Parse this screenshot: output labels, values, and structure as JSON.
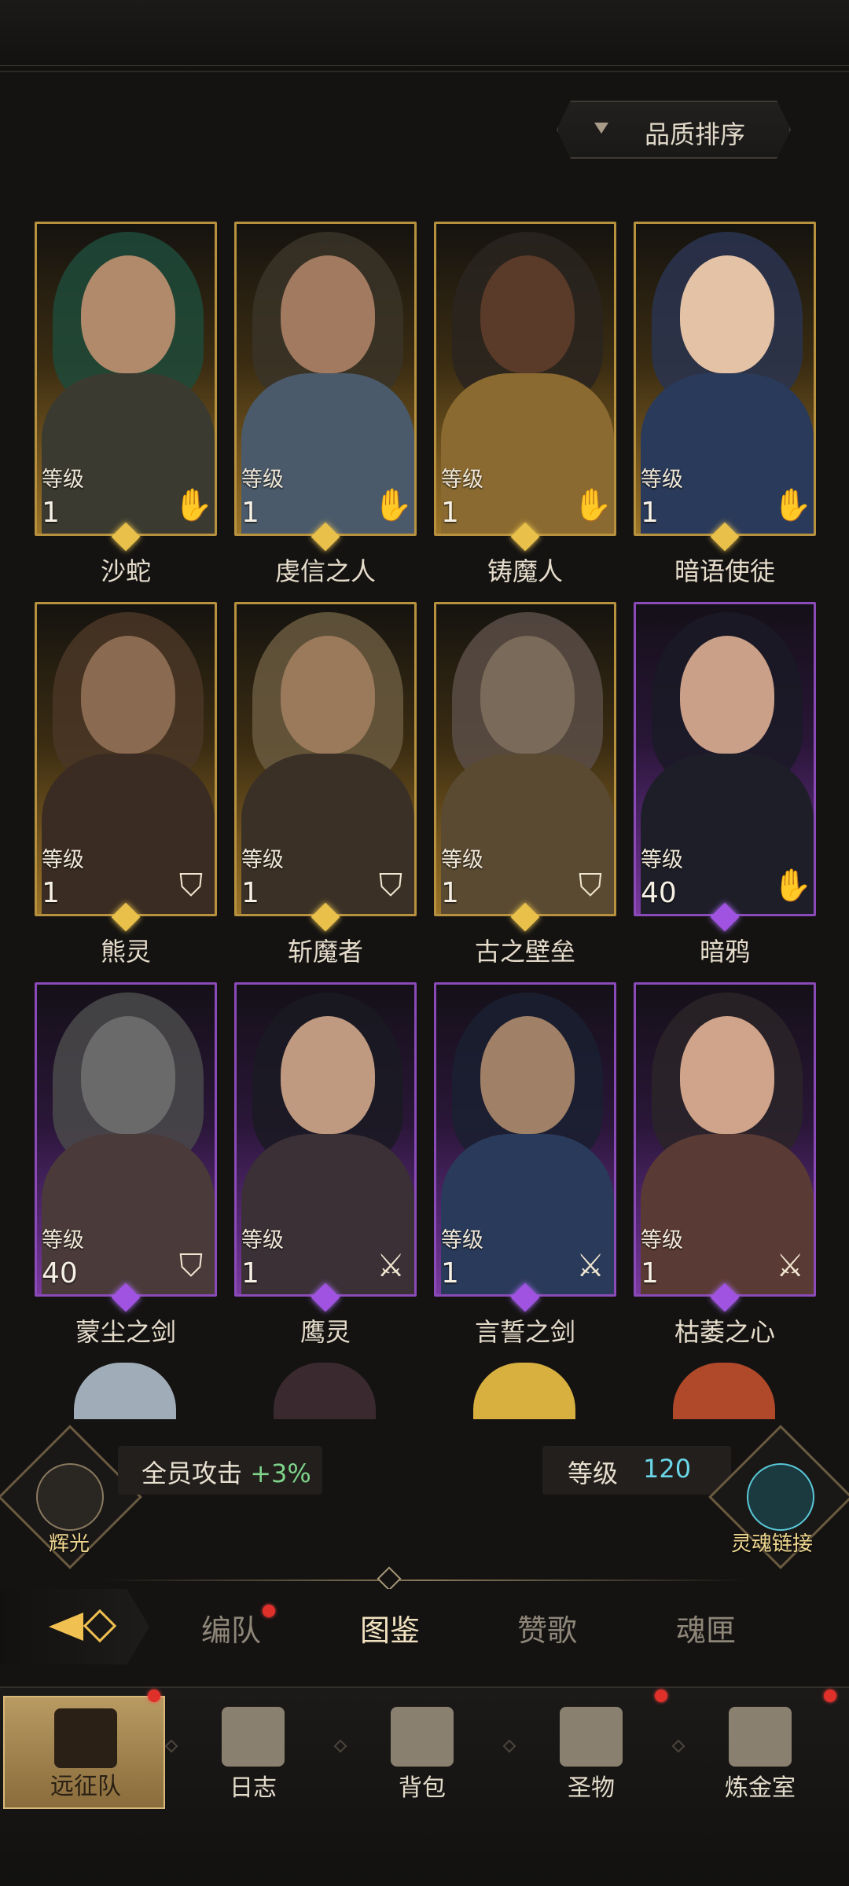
{
  "sort": {
    "label": "品质排序",
    "icon": "triangle-down-icon"
  },
  "partial_names": [
    "",
    "",
    "",
    ""
  ],
  "heroes": [
    {
      "name": "沙蛇",
      "level_label": "等级",
      "level": "1",
      "rarity": "gold",
      "class_icon": "hand-icon",
      "hood": "#1e4a3a",
      "skin": "#b08a6a",
      "body": "#3a3a30"
    },
    {
      "name": "虔信之人",
      "level_label": "等级",
      "level": "1",
      "rarity": "gold",
      "class_icon": "hand-icon",
      "hood": "#3a3428",
      "skin": "#a27a60",
      "body": "#4a5a6a"
    },
    {
      "name": "铸魔人",
      "level_label": "等级",
      "level": "1",
      "rarity": "gold",
      "class_icon": "hand-icon",
      "hood": "#2a2420",
      "skin": "#5a3a28",
      "body": "#8a6a30"
    },
    {
      "name": "暗语使徒",
      "level_label": "等级",
      "level": "1",
      "rarity": "gold",
      "class_icon": "hand-icon",
      "hood": "#2a3450",
      "skin": "#e4c2a6",
      "body": "#2a3a5a"
    },
    {
      "name": "熊灵",
      "level_label": "等级",
      "level": "1",
      "rarity": "gold",
      "class_icon": "shield-icon",
      "hood": "#4a3626",
      "skin": "#8a6a50",
      "body": "#3a2c22"
    },
    {
      "name": "斩魔者",
      "level_label": "等级",
      "level": "1",
      "rarity": "gold",
      "class_icon": "shield-icon",
      "hood": "#6a5a40",
      "skin": "#9a7a5a",
      "body": "#3a3026"
    },
    {
      "name": "古之壁垒",
      "level_label": "等级",
      "level": "1",
      "rarity": "gold",
      "class_icon": "shield-icon",
      "hood": "#5a4e46",
      "skin": "#7a6a5a",
      "body": "#5a4a32"
    },
    {
      "name": "暗鸦",
      "level_label": "等级",
      "level": "40",
      "rarity": "purple",
      "class_icon": "hand-icon",
      "hood": "#1a1a26",
      "skin": "#caa088",
      "body": "#1e1e28"
    },
    {
      "name": "蒙尘之剑",
      "level_label": "等级",
      "level": "40",
      "rarity": "purple",
      "class_icon": "shield-icon",
      "hood": "#4a4a4a",
      "skin": "#6a6a6a",
      "body": "#4a3a3a"
    },
    {
      "name": "鹰灵",
      "level_label": "等级",
      "level": "1",
      "rarity": "purple",
      "class_icon": "sword-icon",
      "hood": "#1a1a22",
      "skin": "#c09a80",
      "body": "#3a3036"
    },
    {
      "name": "言誓之剑",
      "level_label": "等级",
      "level": "1",
      "rarity": "purple",
      "class_icon": "sword-icon",
      "hood": "#1a2030",
      "skin": "#a08066",
      "body": "#2a3a5a"
    },
    {
      "name": "枯萎之心",
      "level_label": "等级",
      "level": "1",
      "rarity": "purple",
      "class_icon": "sword-icon",
      "hood": "#2a2428",
      "skin": "#d0a48a",
      "body": "#5a3a34"
    }
  ],
  "partial_row": [
    {
      "hair": "#a0acb8"
    },
    {
      "hair": "#3a2a30"
    },
    {
      "hair": "#d8b040"
    },
    {
      "hair": "#b0482a"
    }
  ],
  "buff": {
    "emblem_label": "辉光",
    "text": "全员攻击",
    "value": "+3%",
    "level_label": "等级",
    "level_value": "120",
    "link_label": "灵魂链接"
  },
  "subtabs": [
    {
      "label": "编队",
      "active": false,
      "dot": true
    },
    {
      "label": "图鉴",
      "active": true,
      "dot": false
    },
    {
      "label": "赞歌",
      "active": false,
      "dot": false
    },
    {
      "label": "魂匣",
      "active": false,
      "dot": false
    }
  ],
  "nav": [
    {
      "label": "远征队",
      "icon": "horned-helmet-icon",
      "active": true,
      "dot": true
    },
    {
      "label": "日志",
      "icon": "scroll-map-icon",
      "active": false,
      "dot": false
    },
    {
      "label": "背包",
      "icon": "backpack-icon",
      "active": false,
      "dot": false
    },
    {
      "label": "圣物",
      "icon": "chalice-icon",
      "active": false,
      "dot": true
    },
    {
      "label": "炼金室",
      "icon": "alchemy-icon",
      "active": false,
      "dot": true
    }
  ],
  "colors": {
    "gold": "#b8913e",
    "purple": "#8a4ab8",
    "buff_green": "#7ed48a",
    "level_cyan": "#6ad6e8",
    "notify_red": "#e0302a"
  }
}
